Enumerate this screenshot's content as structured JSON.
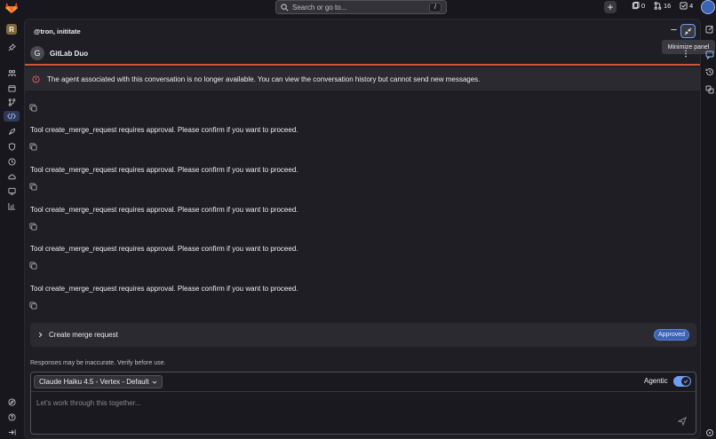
{
  "topbar": {
    "search_placeholder": "Search or go to...",
    "search_shortcut": "/",
    "plus_label": "+",
    "issues_count": "0",
    "merge_requests_count": "16",
    "todos_count": "4"
  },
  "sidebar": {
    "project_initial": "R"
  },
  "panel": {
    "header": "@tron, inititate",
    "tooltip": "Minimize panel",
    "duo_initial": "G",
    "duo_title": "GitLab Duo",
    "alert": "The agent associated with this conversation is no longer available. You can view the conversation history but cannot send new messages.",
    "messages": [
      "Tool create_merge_request requires approval. Please confirm if you want to proceed.",
      "Tool create_merge_request requires approval. Please confirm if you want to proceed.",
      "Tool create_merge_request requires approval. Please confirm if you want to proceed.",
      "Tool create_merge_request requires approval. Please confirm if you want to proceed.",
      "Tool create_merge_request requires approval. Please confirm if you want to proceed."
    ],
    "merge_card": {
      "label": "Create merge request",
      "badge": "Approved"
    },
    "disclaimer": "Responses may be inaccurate. Verify before use.",
    "composer": {
      "model": "Claude Haiku 4.5 - Vertex - Default",
      "agentic_label": "Agentic",
      "agentic_on": true,
      "placeholder": "Let's work through this together..."
    }
  },
  "colors": {
    "accent": "#6e9ef5",
    "alert_icon": "#dd6b5b",
    "duo_underline": "#c9573a",
    "background": "#18171d",
    "panel": "#1f1e24"
  }
}
